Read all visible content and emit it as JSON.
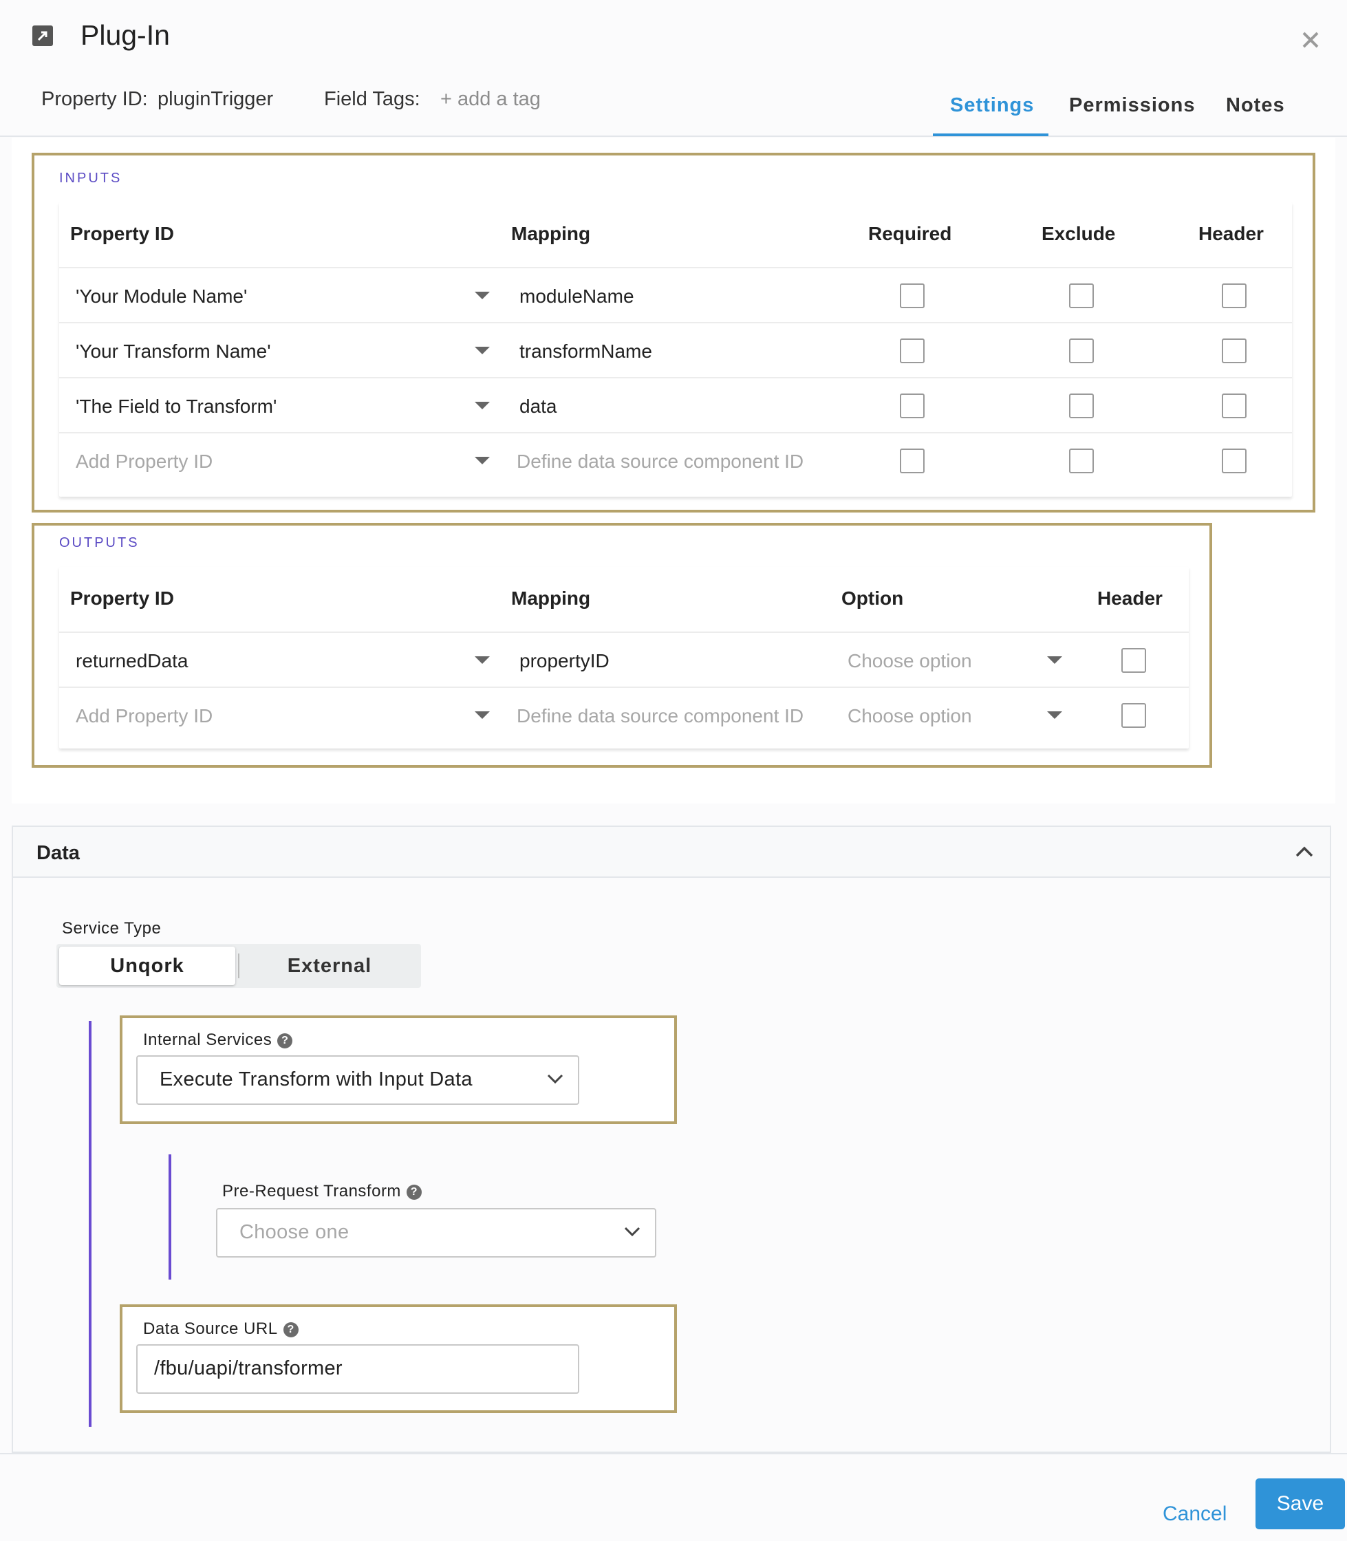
{
  "header": {
    "title": "Plug-In",
    "property_id_label": "Property ID:",
    "property_id_value": "pluginTrigger",
    "field_tags_label": "Field Tags:",
    "add_tag": "+ add a tag",
    "tabs": [
      {
        "label": "Settings",
        "active": true
      },
      {
        "label": "Permissions",
        "active": false
      },
      {
        "label": "Notes",
        "active": false
      }
    ]
  },
  "inputs": {
    "caption": "INPUTS",
    "columns": [
      "Property ID",
      "Mapping",
      "Required",
      "Exclude",
      "Header"
    ],
    "rows": [
      {
        "property_id": "'Your Module Name'",
        "mapping": "moduleName",
        "required": false,
        "exclude": false,
        "header": false
      },
      {
        "property_id": "'Your Transform Name'",
        "mapping": "transformName",
        "required": false,
        "exclude": false,
        "header": false
      },
      {
        "property_id": "'The Field to Transform'",
        "mapping": "data",
        "required": false,
        "exclude": false,
        "header": false
      }
    ],
    "new_row": {
      "property_id_placeholder": "Add Property ID",
      "mapping_placeholder": "Define data source component ID"
    }
  },
  "outputs": {
    "caption": "OUTPUTS",
    "columns": [
      "Property ID",
      "Mapping",
      "Option",
      "Header"
    ],
    "rows": [
      {
        "property_id": "returnedData",
        "mapping": "propertyID",
        "option_placeholder": "Choose option",
        "header": false
      }
    ],
    "new_row": {
      "property_id_placeholder": "Add Property ID",
      "mapping_placeholder": "Define data source component ID",
      "option_placeholder": "Choose option"
    }
  },
  "data_panel": {
    "title": "Data",
    "service_type": {
      "label": "Service Type",
      "options": [
        "Unqork",
        "External"
      ],
      "selected": "Unqork"
    },
    "internal_services": {
      "label": "Internal Services",
      "value": "Execute Transform with Input Data"
    },
    "pre_request_transform": {
      "label": "Pre-Request Transform",
      "placeholder": "Choose one"
    },
    "data_source_url": {
      "label": "Data Source URL",
      "value": "/fbu/uapi/transformer"
    },
    "help_glyph": "?"
  },
  "footer": {
    "cancel_label": "Cancel",
    "save_label": "Save"
  },
  "colors": {
    "accent": "#2f93d8",
    "highlight_border": "#b5a26a",
    "section_caption": "#5b4bc4",
    "indent_bar": "#6a4bd1"
  }
}
